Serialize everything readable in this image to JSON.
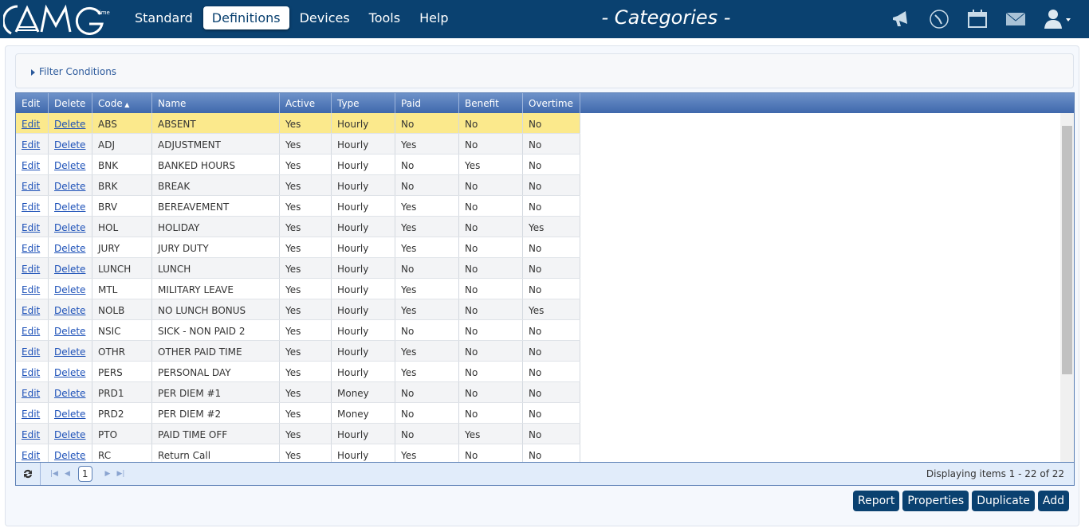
{
  "header": {
    "logo_text": "AMG time",
    "nav": [
      "Standard",
      "Definitions",
      "Devices",
      "Tools",
      "Help"
    ],
    "active_nav": "Definitions",
    "title": "- Categories -",
    "icons": [
      "megaphone-icon",
      "clock-icon",
      "calendar-icon",
      "mail-icon",
      "user-icon"
    ]
  },
  "filter": {
    "label": "Filter Conditions"
  },
  "grid": {
    "columns": [
      "Edit",
      "Delete",
      "Code",
      "Name",
      "Active",
      "Type",
      "Paid",
      "Benefit",
      "Overtime"
    ],
    "sort_column": "Code",
    "sort_dir": "asc",
    "rows": [
      [
        "ABS",
        "ABSENT",
        "Yes",
        "Hourly",
        "No",
        "No",
        "No"
      ],
      [
        "ADJ",
        "ADJUSTMENT",
        "Yes",
        "Hourly",
        "Yes",
        "No",
        "No"
      ],
      [
        "BNK",
        "BANKED HOURS",
        "Yes",
        "Hourly",
        "No",
        "Yes",
        "No"
      ],
      [
        "BRK",
        "BREAK",
        "Yes",
        "Hourly",
        "No",
        "No",
        "No"
      ],
      [
        "BRV",
        "BEREAVEMENT",
        "Yes",
        "Hourly",
        "Yes",
        "No",
        "No"
      ],
      [
        "HOL",
        "HOLIDAY",
        "Yes",
        "Hourly",
        "Yes",
        "No",
        "Yes"
      ],
      [
        "JURY",
        "JURY DUTY",
        "Yes",
        "Hourly",
        "Yes",
        "No",
        "No"
      ],
      [
        "LUNCH",
        "LUNCH",
        "Yes",
        "Hourly",
        "No",
        "No",
        "No"
      ],
      [
        "MTL",
        "MILITARY LEAVE",
        "Yes",
        "Hourly",
        "Yes",
        "No",
        "No"
      ],
      [
        "NOLB",
        "NO LUNCH BONUS",
        "Yes",
        "Hourly",
        "Yes",
        "No",
        "Yes"
      ],
      [
        "NSIC",
        "SICK - NON PAID 2",
        "Yes",
        "Hourly",
        "No",
        "No",
        "No"
      ],
      [
        "OTHR",
        "OTHER PAID TIME",
        "Yes",
        "Hourly",
        "Yes",
        "No",
        "No"
      ],
      [
        "PERS",
        "PERSONAL DAY",
        "Yes",
        "Hourly",
        "Yes",
        "No",
        "No"
      ],
      [
        "PRD1",
        "PER DIEM #1",
        "Yes",
        "Money",
        "No",
        "No",
        "No"
      ],
      [
        "PRD2",
        "PER DIEM #2",
        "Yes",
        "Money",
        "No",
        "No",
        "No"
      ],
      [
        "PTO",
        "PAID TIME OFF",
        "Yes",
        "Hourly",
        "No",
        "Yes",
        "No"
      ],
      [
        "RC",
        "Return Call",
        "Yes",
        "Hourly",
        "Yes",
        "No",
        "No"
      ]
    ],
    "edit_label": "Edit",
    "delete_label": "Delete",
    "selected_row": 0
  },
  "pager": {
    "page": "1",
    "display": "Displaying items 1 - 22 of 22"
  },
  "buttons": [
    "Report",
    "Properties",
    "Duplicate",
    "Add"
  ],
  "colors": {
    "header_bg": "#0a4170",
    "selected_row": "#fbe98c"
  }
}
